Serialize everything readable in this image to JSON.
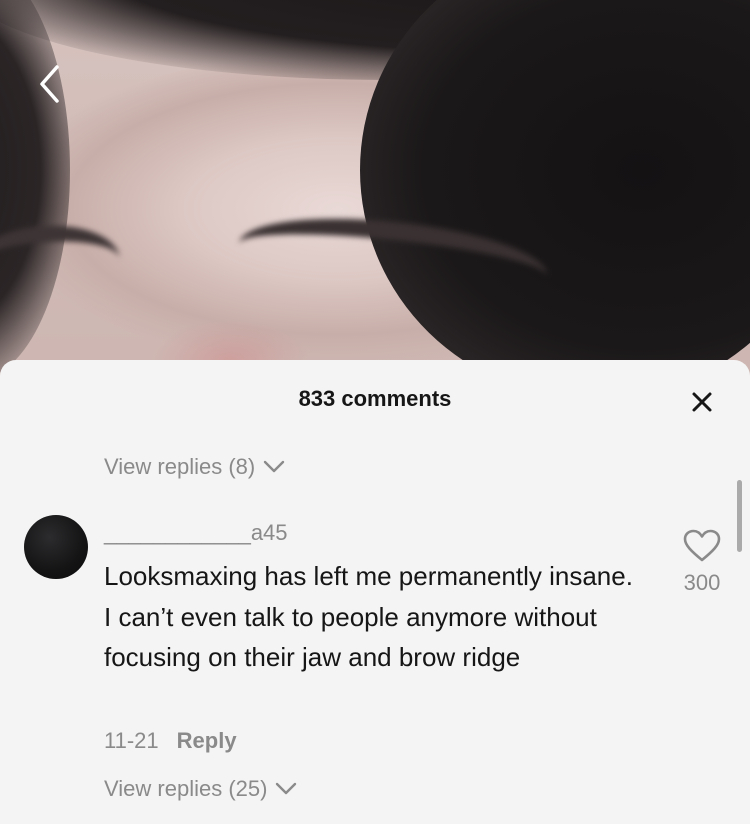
{
  "video": {
    "back_icon": "chevron-left-icon"
  },
  "sheet": {
    "title": "833 comments",
    "close_icon": "close-icon"
  },
  "replies_top": {
    "label": "View replies (8)",
    "icon": "chevron-down-icon"
  },
  "comment": {
    "username": "____________a45",
    "text": "Looksmaxing has left me permanently insane. I can’t even talk to people anymore without focusing on their jaw and brow ridge",
    "date": "11-21",
    "reply_label": "Reply",
    "like_icon": "heart-icon",
    "like_count": "300"
  },
  "replies_bottom": {
    "label": "View replies (25)",
    "icon": "chevron-down-icon"
  },
  "colors": {
    "sheet_background": "#f4f4f4",
    "primary_text": "#161616",
    "secondary_text": "#8a8a8a"
  }
}
